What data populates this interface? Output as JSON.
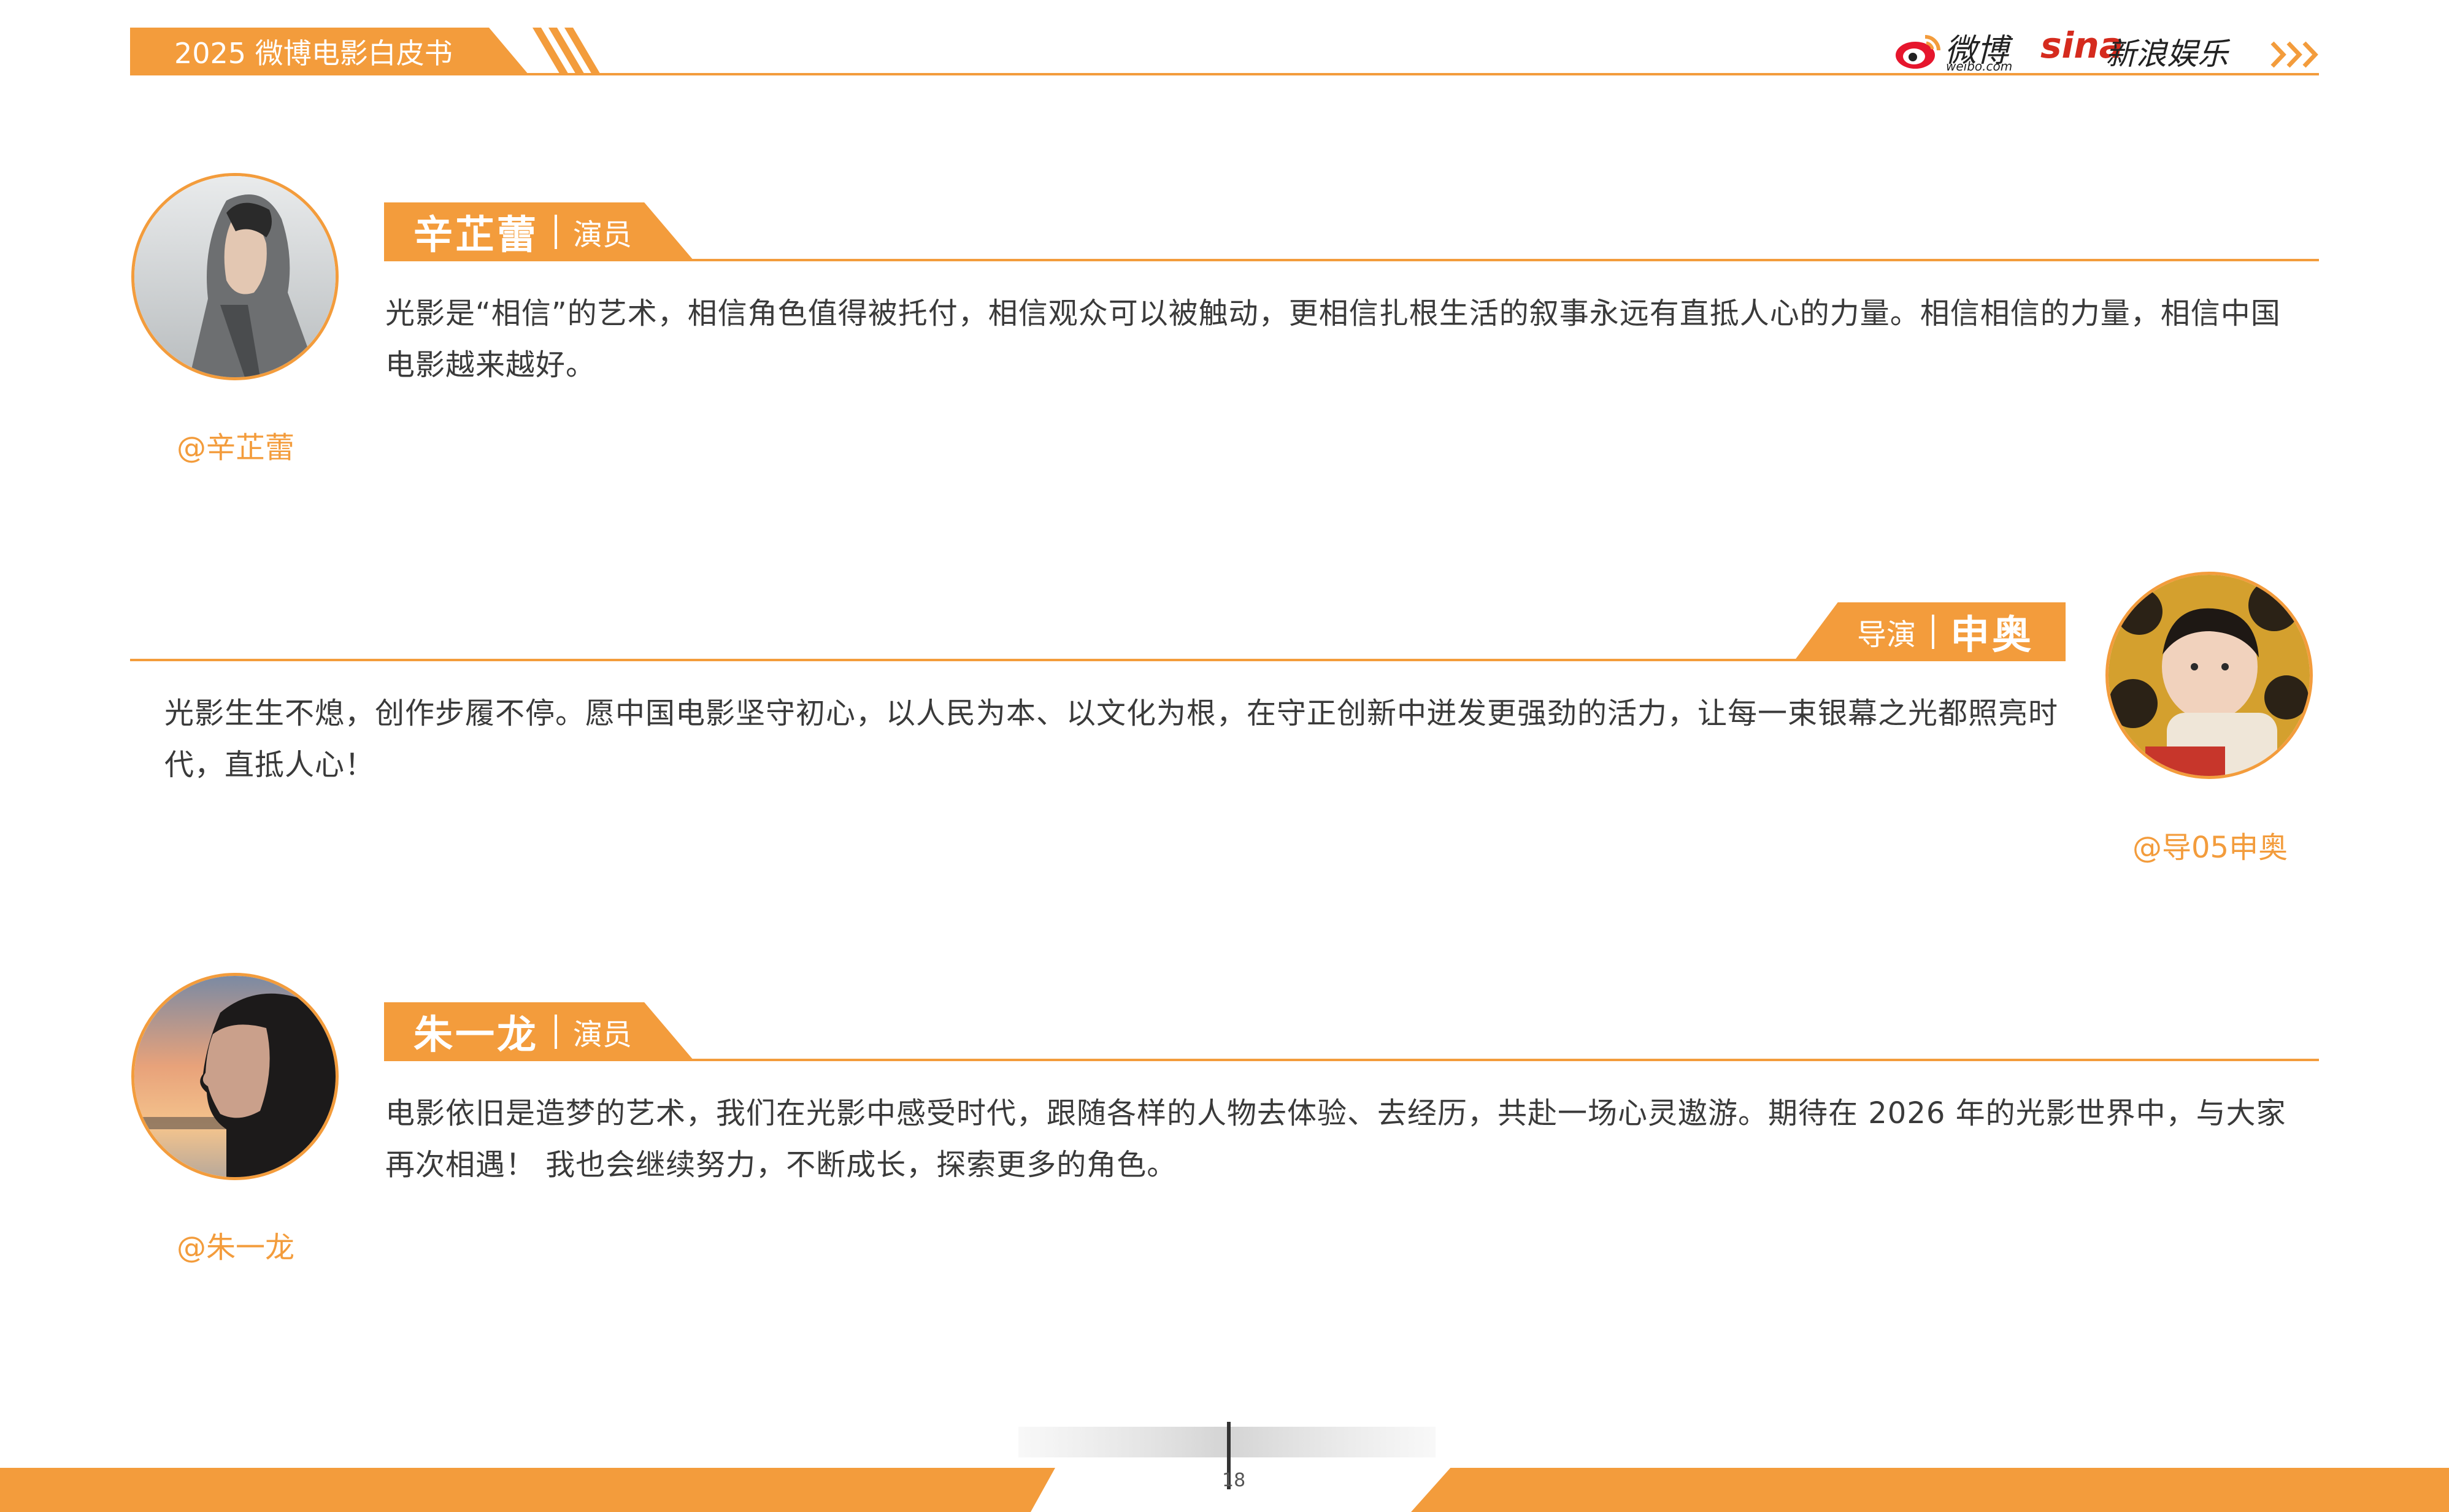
{
  "header": {
    "title": "2025 微博电影白皮书",
    "weibo_logo_text": "微博",
    "weibo_logo_domain": "weibo.com",
    "sina_logo_text": "sina",
    "sina_ent_text": "新浪娱乐",
    "accent_color": "#f39c3c"
  },
  "people": [
    {
      "name": "辛芷蕾",
      "role": "演员",
      "handle": "@辛芷蕾",
      "quote": "光影是“相信”的艺术，相信角色值得被托付，相信观众可以被触动，更相信扎根生活的叙事永远有直抵人心的力量。相信相信的力量，相信中国电影越来越好。",
      "avatar_icon": "portrait-hooded-woman"
    },
    {
      "name": "申奥",
      "role": "导演",
      "handle": "@导05申奥",
      "quote": "光影生生不熄，创作步履不停。愿中国电影坚守初心，以人民为本、以文化为根，在守正创新中迸发更强劲的活力，让每一束银幕之光都照亮时代，直抵人心！",
      "avatar_icon": "portrait-child"
    },
    {
      "name": "朱一龙",
      "role": "演员",
      "handle": "@朱一龙",
      "quote": "电影依旧是造梦的艺术，我们在光影中感受时代，跟随各样的人物去体验、去经历，共赴一场心灵遨游。期待在 2026 年的光影世界中，与大家再次相遇！ 我也会继续努力，不断成长，探索更多的角色。",
      "avatar_icon": "portrait-man-sunset"
    }
  ],
  "footer": {
    "page_number": "18"
  }
}
